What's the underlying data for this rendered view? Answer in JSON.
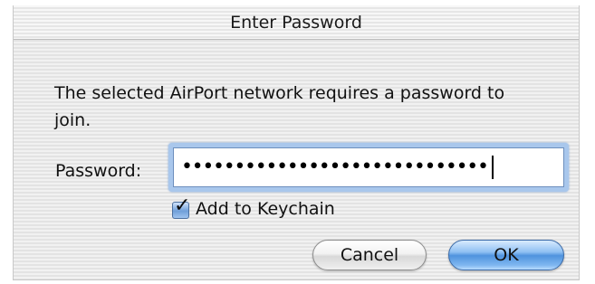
{
  "dialog": {
    "title": "Enter Password",
    "message": "The selected AirPort network requires a password to join.",
    "password_label": "Password:",
    "password_value": "•••••••••••••••••••••••••••••",
    "checkbox_label": "Add to Keychain",
    "checkbox_checked": true,
    "cancel_label": "Cancel",
    "ok_label": "OK"
  },
  "icons": {
    "checkbox": "checkmark-icon"
  },
  "colors": {
    "focus_ring": "#a9c7ec",
    "default_button": "#4f93de"
  }
}
